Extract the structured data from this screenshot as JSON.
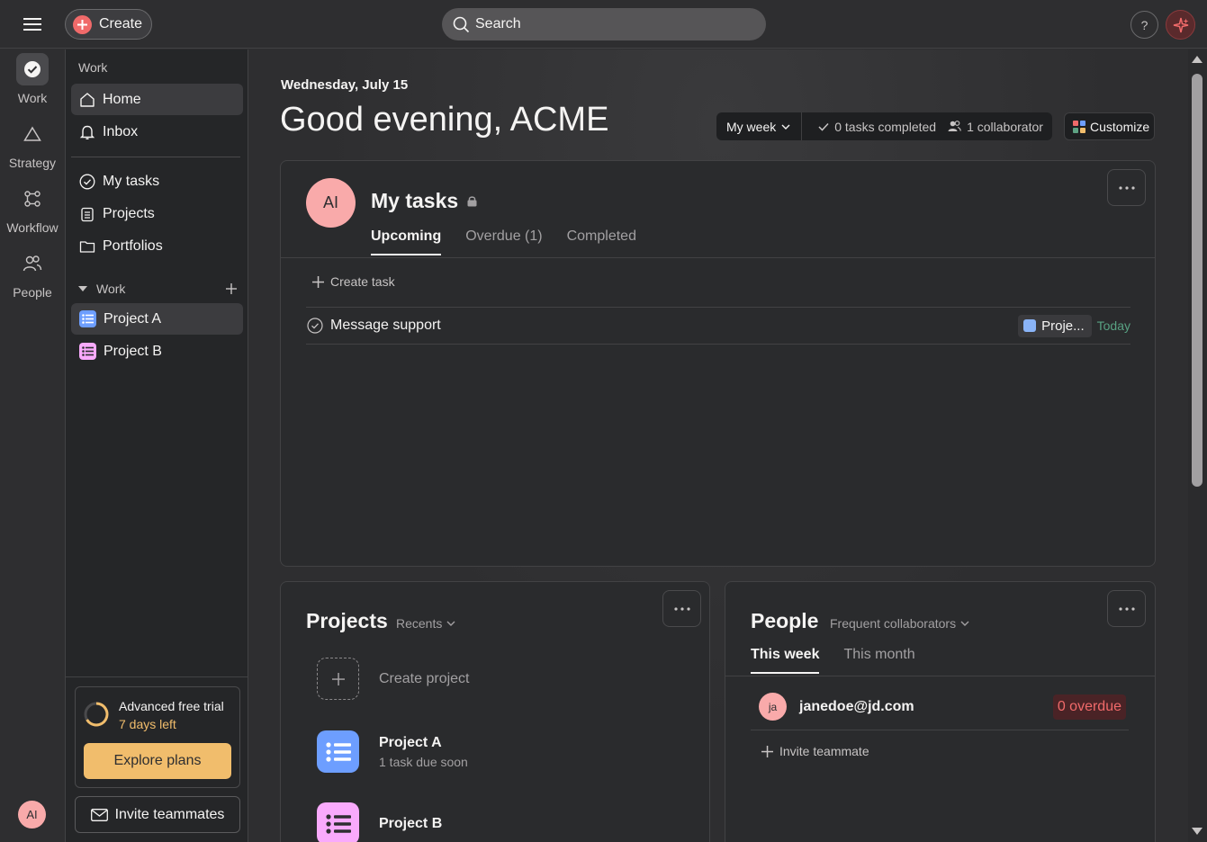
{
  "topbar": {
    "create_label": "Create",
    "search_placeholder": "Search",
    "help_label": "?"
  },
  "rail": {
    "items": [
      {
        "label": "Work",
        "icon": "check-circle-icon"
      },
      {
        "label": "Strategy",
        "icon": "triangle-icon"
      },
      {
        "label": "Workflow",
        "icon": "workflow-icon"
      },
      {
        "label": "People",
        "icon": "people-icon"
      }
    ],
    "avatar_initials": "AI"
  },
  "sidebar": {
    "header": "Work",
    "nav": [
      {
        "label": "Home",
        "icon": "home-icon"
      },
      {
        "label": "Inbox",
        "icon": "bell-icon"
      },
      {
        "label": "My tasks",
        "icon": "check-circle-icon"
      },
      {
        "label": "Projects",
        "icon": "clipboard-icon"
      },
      {
        "label": "Portfolios",
        "icon": "folder-icon"
      }
    ],
    "section_label": "Work",
    "projects": [
      {
        "label": "Project A",
        "color": "#6d9eff"
      },
      {
        "label": "Project B",
        "color": "#f9aafc"
      }
    ],
    "trial": {
      "title": "Advanced free trial",
      "days_left": "7 days left",
      "cta": "Explore plans"
    },
    "invite_label": "Invite teammates"
  },
  "main": {
    "date": "Wednesday, July 15",
    "greeting": "Good evening, ACME",
    "stats": {
      "range": "My week",
      "completed": "0 tasks completed",
      "collaborators": "1 collaborator"
    },
    "customize_label": "Customize"
  },
  "my_tasks": {
    "avatar_initials": "AI",
    "title": "My tasks",
    "tabs": [
      "Upcoming",
      "Overdue (1)",
      "Completed"
    ],
    "create_label": "Create task",
    "tasks": [
      {
        "name": "Message support",
        "project": "Proje...",
        "due": "Today"
      }
    ]
  },
  "projects_card": {
    "title": "Projects",
    "filter": "Recents",
    "create_label": "Create project",
    "items": [
      {
        "name": "Project A",
        "subtitle": "1 task due soon",
        "color": "#6d9eff"
      },
      {
        "name": "Project B",
        "subtitle": "",
        "color": "#f9aafc"
      }
    ]
  },
  "people_card": {
    "title": "People",
    "filter": "Frequent collaborators",
    "tabs": [
      "This week",
      "This month"
    ],
    "people": [
      {
        "initials": "ja",
        "email": "janedoe@jd.com",
        "overdue": "0 overdue"
      }
    ],
    "invite_label": "Invite teammate"
  },
  "colors": {
    "accent_red": "#f06a6a",
    "accent_gold": "#f1bd6c",
    "due_green": "#58a182"
  }
}
